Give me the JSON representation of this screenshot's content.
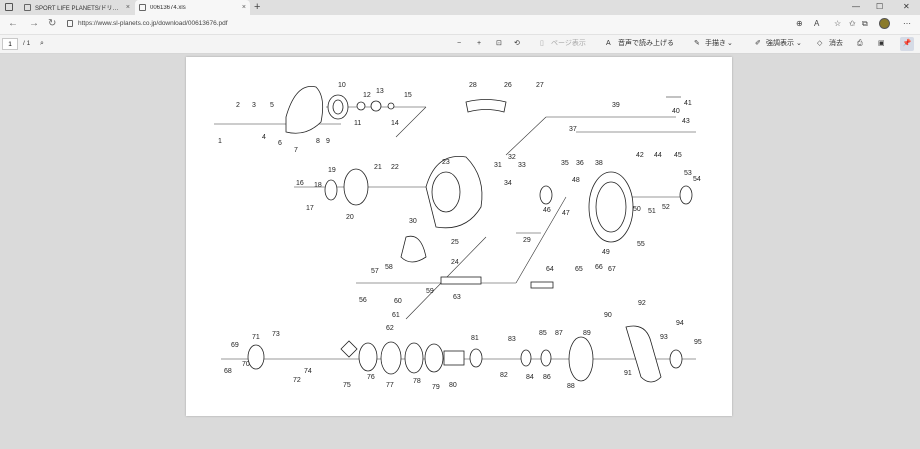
{
  "tabs": [
    {
      "title": "SPORT LIFE PLANETS/ドリーデ SV TW",
      "close": "×"
    },
    {
      "title": "00613674.xls",
      "close": "×"
    }
  ],
  "new_tab": "+",
  "window_controls": {
    "minimize": "—",
    "maximize": "☐",
    "close": "✕"
  },
  "address": {
    "url": "https://www.sl-planets.co.jp/download/00613676.pdf"
  },
  "pdf_toolbar": {
    "page_current": "1",
    "page_total": "/ 1",
    "zoom_out": "−",
    "zoom_in": "+",
    "page_view": "ページ表示",
    "read_aloud": "音声で読み上げる",
    "draw": "手描き",
    "highlight": "強調表示",
    "erase": "消去"
  },
  "diagram": {
    "callouts": [
      "1",
      "2",
      "3",
      "4",
      "5",
      "6",
      "7",
      "8",
      "9",
      "10",
      "11",
      "12",
      "13",
      "14",
      "15",
      "16",
      "17",
      "18",
      "19",
      "20",
      "21",
      "22",
      "23",
      "24",
      "25",
      "26",
      "27",
      "28",
      "29",
      "30",
      "31",
      "32",
      "33",
      "34",
      "35",
      "36",
      "37",
      "38",
      "39",
      "40",
      "41",
      "42",
      "43",
      "44",
      "45",
      "46",
      "47",
      "48",
      "49",
      "50",
      "51",
      "52",
      "53",
      "54",
      "55",
      "56",
      "57",
      "58",
      "59",
      "60",
      "61",
      "62",
      "63",
      "64",
      "65",
      "66",
      "67",
      "68",
      "69",
      "70",
      "71",
      "72",
      "73",
      "74",
      "75",
      "76",
      "77",
      "78",
      "79",
      "80",
      "81",
      "82",
      "83",
      "84",
      "85",
      "86",
      "87",
      "88",
      "89",
      "90",
      "91",
      "92",
      "93",
      "94",
      "95"
    ]
  }
}
